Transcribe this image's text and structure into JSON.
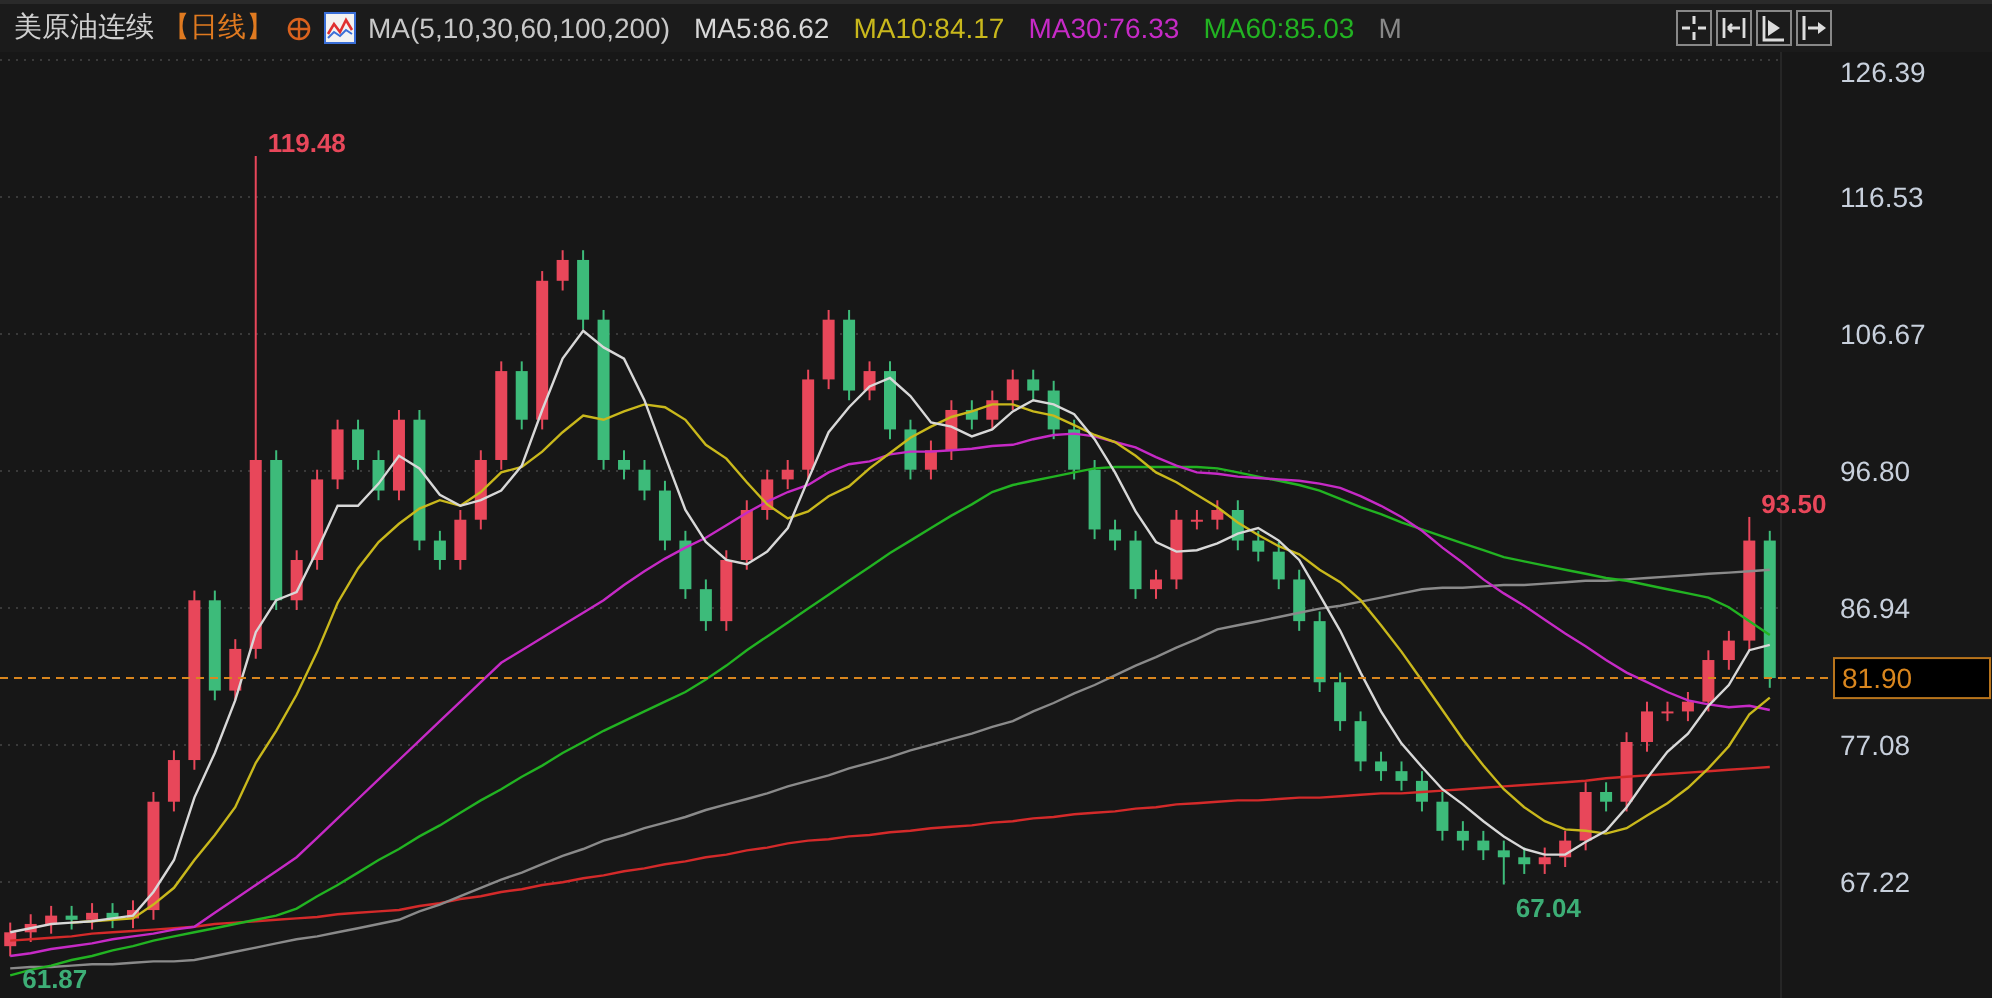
{
  "header": {
    "title": "美原油连续",
    "period": "【日线】",
    "indicator": "MA(5,10,30,60,100,200)",
    "ma_values": [
      {
        "label": "MA5:86.62",
        "color": "#d8d8d8"
      },
      {
        "label": "MA10:84.17",
        "color": "#c9b81c"
      },
      {
        "label": "MA30:76.33",
        "color": "#c62ac6"
      },
      {
        "label": "MA60:85.03",
        "color": "#22b322"
      }
    ],
    "more": "M"
  },
  "chart_data": {
    "type": "candlestick",
    "grid": true,
    "ylim": [
      58.87,
      126.97
    ],
    "categories": [
      null,
      null,
      null,
      null,
      null,
      null,
      null,
      null,
      null,
      null,
      null,
      null,
      null,
      null,
      null,
      null,
      null,
      null,
      null,
      null,
      null,
      null,
      null,
      null,
      null,
      null,
      null,
      null,
      null,
      null,
      null,
      null,
      null,
      null,
      null,
      null,
      null,
      null,
      null,
      null,
      null,
      null,
      null,
      null,
      null,
      null,
      null,
      null,
      null,
      null,
      null,
      null,
      null,
      null,
      null,
      null,
      null,
      null,
      null,
      null,
      null,
      null,
      null,
      null,
      null,
      null,
      null,
      null,
      null,
      null,
      null,
      null,
      null,
      null,
      null,
      null,
      null,
      null,
      null,
      null,
      null,
      null,
      null,
      null,
      null,
      null,
      null
    ],
    "yticks": [
      {
        "value": 126.39,
        "label": "126.39"
      },
      {
        "value": 116.53,
        "label": "116.53"
      },
      {
        "value": 106.67,
        "label": "106.67"
      },
      {
        "value": 96.8,
        "label": "96.80"
      },
      {
        "value": 86.94,
        "label": "86.94"
      },
      {
        "value": 77.08,
        "label": "77.08"
      },
      {
        "value": 67.22,
        "label": "67.22"
      }
    ],
    "ohlc": [
      [
        62.6,
        64.3,
        61.87,
        63.6
      ],
      [
        63.6,
        64.9,
        62.9,
        64.2
      ],
      [
        64.2,
        65.5,
        63.5,
        64.8
      ],
      [
        64.8,
        65.5,
        63.8,
        64.5
      ],
      [
        64.5,
        65.7,
        63.8,
        65
      ],
      [
        65,
        65.7,
        63.9,
        64.6
      ],
      [
        64.6,
        65.9,
        63.9,
        65.2
      ],
      [
        65.2,
        73.7,
        64.5,
        73
      ],
      [
        73,
        76.7,
        72.3,
        76
      ],
      [
        76,
        88.2,
        75.3,
        87.5
      ],
      [
        87.5,
        88.2,
        80.3,
        81
      ],
      [
        81,
        84.7,
        80.3,
        84
      ],
      [
        84,
        119.48,
        83.3,
        97.6
      ],
      [
        97.6,
        98.3,
        86.8,
        87.5
      ],
      [
        87.5,
        91.1,
        86.8,
        90.4
      ],
      [
        90.4,
        96.9,
        89.7,
        96.2
      ],
      [
        96.2,
        100.5,
        95.5,
        99.8
      ],
      [
        99.8,
        100.5,
        96.9,
        97.6
      ],
      [
        97.6,
        98.3,
        94.7,
        95.4
      ],
      [
        95.4,
        101.2,
        94.7,
        100.5
      ],
      [
        100.5,
        101.2,
        91.1,
        91.8
      ],
      [
        91.8,
        92.5,
        89.7,
        90.4
      ],
      [
        90.4,
        94,
        89.7,
        93.3
      ],
      [
        93.3,
        98.3,
        92.6,
        97.6
      ],
      [
        97.6,
        104.7,
        96.9,
        104
      ],
      [
        104,
        104.7,
        99.8,
        100.5
      ],
      [
        100.5,
        111.2,
        99.8,
        110.5
      ],
      [
        110.5,
        112.7,
        109.8,
        112
      ],
      [
        112,
        112.7,
        107,
        107.7
      ],
      [
        107.7,
        108.4,
        96.9,
        97.6
      ],
      [
        97.6,
        98.3,
        96.2,
        96.9
      ],
      [
        96.9,
        97.6,
        94.7,
        95.4
      ],
      [
        95.4,
        96.1,
        91.1,
        91.8
      ],
      [
        91.8,
        92.5,
        87.6,
        88.3
      ],
      [
        88.3,
        89,
        85.3,
        86
      ],
      [
        86,
        91.1,
        85.3,
        90.4
      ],
      [
        90.4,
        94.7,
        89.7,
        94
      ],
      [
        94,
        96.9,
        93.3,
        96.2
      ],
      [
        96.2,
        97.6,
        95.5,
        96.9
      ],
      [
        96.9,
        104.1,
        96.2,
        103.4
      ],
      [
        103.4,
        108.4,
        102.7,
        107.7
      ],
      [
        107.7,
        108.4,
        101.9,
        102.6
      ],
      [
        102.6,
        104.7,
        101.9,
        104
      ],
      [
        104,
        104.7,
        99.1,
        99.8
      ],
      [
        99.8,
        100.5,
        96.2,
        96.9
      ],
      [
        96.9,
        99,
        96.2,
        98.3
      ],
      [
        98.3,
        101.9,
        97.6,
        101.2
      ],
      [
        101.2,
        101.9,
        99.8,
        100.5
      ],
      [
        100.5,
        102.6,
        99.8,
        101.9
      ],
      [
        101.9,
        104.1,
        101.2,
        103.4
      ],
      [
        103.4,
        104.1,
        101.9,
        102.6
      ],
      [
        102.6,
        103.3,
        99.1,
        99.8
      ],
      [
        99.8,
        100.5,
        96.2,
        96.9
      ],
      [
        96.9,
        97.6,
        91.9,
        92.6
      ],
      [
        92.6,
        93.3,
        91.1,
        91.8
      ],
      [
        91.8,
        92.5,
        87.6,
        88.3
      ],
      [
        88.3,
        89.7,
        87.6,
        89
      ],
      [
        89,
        94,
        88.3,
        93.3
      ],
      [
        93.3,
        94,
        92.6,
        93.3
      ],
      [
        93.3,
        94.7,
        92.6,
        94
      ],
      [
        94,
        94.7,
        91.1,
        91.8
      ],
      [
        91.8,
        92.5,
        90.3,
        91
      ],
      [
        91,
        91.7,
        88.3,
        89
      ],
      [
        89,
        89.7,
        85.3,
        86
      ],
      [
        86,
        86.7,
        80.9,
        81.6
      ],
      [
        81.6,
        82.3,
        78.1,
        78.8
      ],
      [
        78.8,
        79.5,
        75.2,
        75.9
      ],
      [
        75.9,
        76.6,
        74.5,
        75.2
      ],
      [
        75.2,
        75.9,
        73.8,
        74.5
      ],
      [
        74.5,
        75.2,
        72.3,
        73
      ],
      [
        73,
        73.7,
        70.2,
        70.9
      ],
      [
        70.9,
        71.6,
        69.5,
        70.2
      ],
      [
        70.2,
        70.9,
        68.8,
        69.5
      ],
      [
        69.5,
        70.2,
        67.04,
        69
      ],
      [
        69,
        69.7,
        67.8,
        68.5
      ],
      [
        68.5,
        69.7,
        67.8,
        69
      ],
      [
        69,
        70.9,
        68.3,
        70.2
      ],
      [
        70.2,
        74.4,
        69.5,
        73.7
      ],
      [
        73.7,
        74.4,
        72.3,
        73
      ],
      [
        73,
        78,
        72.3,
        77.3
      ],
      [
        77.3,
        80.2,
        76.6,
        79.5
      ],
      [
        79.5,
        80.2,
        78.8,
        79.5
      ],
      [
        79.5,
        80.9,
        78.8,
        80.2
      ],
      [
        80.2,
        83.9,
        79.5,
        83.2
      ],
      [
        83.2,
        85.3,
        82.5,
        84.6
      ],
      [
        84.6,
        93.5,
        83.9,
        91.8
      ],
      [
        91.8,
        92.5,
        81.2,
        81.9
      ]
    ],
    "series": [
      {
        "type": "line",
        "color": "#d8d8d8",
        "values": [
          63.6,
          63.9,
          64.2,
          64.3,
          64.4,
          64.6,
          64.8,
          66.5,
          68.8,
          73.3,
          76.5,
          80.3,
          85.2,
          87.5,
          88.1,
          91.1,
          94.3,
          94.3,
          95.9,
          97.9,
          97,
          95.1,
          94.3,
          94.7,
          95.4,
          97.2,
          101.2,
          104.9,
          106.9,
          105.7,
          104.9,
          101.9,
          97.9,
          94,
          91.7,
          90.4,
          90.1,
          91,
          92.7,
          96.2,
          99.6,
          101.4,
          102.9,
          103.5,
          102.2,
          100.3,
          100,
          99.3,
          99.8,
          101.1,
          101.9,
          101.6,
          100.9,
          99.1,
          96.7,
          93.9,
          91.7,
          91,
          91.1,
          91.6,
          92.3,
          92.7,
          91.8,
          90.4,
          87.9,
          85.3,
          82.3,
          79.5,
          77.2,
          75.5,
          73.9,
          72.8,
          71.6,
          70.5,
          69.6,
          69.2,
          69.2,
          70.1,
          70.9,
          72.6,
          74.7,
          76.6,
          77.9,
          79.9,
          81.4,
          83.9,
          84.3
        ]
      },
      {
        "type": "line",
        "color": "#c9b81c",
        "values": [
          null,
          null,
          null,
          64.3,
          64.4,
          64.5,
          64.6,
          65.6,
          66.8,
          68.8,
          70.6,
          72.6,
          75.8,
          78.1,
          80.7,
          83.8,
          87.3,
          89.8,
          91.7,
          93,
          94.1,
          94.7,
          94.3,
          95.3,
          96.7,
          97.1,
          98.2,
          99.6,
          100.8,
          100.5,
          101.1,
          101.6,
          101.4,
          100.5,
          98.7,
          97.7,
          96,
          94.4,
          93.4,
          93.9,
          95,
          95.7,
          97,
          98.1,
          99.2,
          100,
          100.7,
          101.1,
          101.6,
          101.6,
          101.1,
          100.8,
          100.1,
          99.4,
          98.9,
          97.9,
          96.7,
          96,
          95.1,
          94.2,
          93.1,
          92.2,
          91.4,
          90.8,
          89.7,
          88.8,
          87.5,
          85.7,
          83.8,
          81.7,
          79.6,
          77.5,
          75.6,
          73.9,
          72.6,
          71.6,
          71,
          70.9,
          70.7,
          71.1,
          72,
          72.9,
          74,
          75.4,
          77,
          79.3,
          80.5
        ]
      },
      {
        "type": "line",
        "color": "#c62ac6",
        "values": [
          61.9,
          62.1,
          62.4,
          62.6,
          62.8,
          63.1,
          63.3,
          63.5,
          63.8,
          64,
          65,
          66,
          67,
          68,
          69,
          70.4,
          71.8,
          73.2,
          74.6,
          76,
          77.4,
          78.8,
          80.2,
          81.6,
          83,
          83.9,
          84.8,
          85.7,
          86.6,
          87.5,
          88.6,
          89.6,
          90.5,
          91.3,
          92,
          92.9,
          93.8,
          94.6,
          95.3,
          95.8,
          96.7,
          97.3,
          97.5,
          98,
          98.2,
          98.2,
          98.3,
          98.4,
          98.6,
          98.7,
          99.1,
          99.4,
          99.5,
          99.3,
          98.9,
          98.5,
          97.8,
          97.2,
          96.7,
          96.6,
          96.4,
          96.3,
          96.2,
          96.1,
          95.9,
          95.6,
          95,
          94.3,
          93.5,
          92.5,
          91.3,
          90.2,
          89,
          88,
          87.1,
          86.1,
          85.1,
          84.2,
          83.2,
          82.3,
          81.6,
          80.9,
          80.3,
          80,
          79.8,
          79.9,
          79.6
        ]
      },
      {
        "type": "line",
        "color": "#22b322",
        "values": [
          60.5,
          60.9,
          61.2,
          61.6,
          61.9,
          62.3,
          62.6,
          63,
          63.3,
          63.6,
          63.9,
          64.2,
          64.5,
          64.8,
          65.3,
          66.2,
          67,
          67.9,
          68.8,
          69.6,
          70.5,
          71.3,
          72.2,
          73.1,
          73.9,
          74.8,
          75.6,
          76.5,
          77.3,
          78.1,
          78.8,
          79.5,
          80.2,
          80.9,
          81.8,
          82.8,
          83.9,
          84.9,
          85.9,
          86.9,
          87.9,
          88.9,
          89.9,
          90.9,
          91.8,
          92.7,
          93.6,
          94.4,
          95.3,
          95.8,
          96.1,
          96.4,
          96.7,
          97,
          97.1,
          97.1,
          97.1,
          97.1,
          97.1,
          97,
          96.7,
          96.4,
          96.1,
          95.8,
          95.4,
          94.8,
          94.2,
          93.7,
          93.1,
          92.6,
          92.1,
          91.6,
          91.1,
          90.6,
          90.3,
          90,
          89.7,
          89.4,
          89.1,
          88.9,
          88.6,
          88.3,
          88,
          87.7,
          87,
          86,
          85
        ]
      },
      {
        "type": "line",
        "color": "#8a8a8a",
        "values": [
          61,
          61.1,
          61.1,
          61.2,
          61.3,
          61.3,
          61.4,
          61.5,
          61.5,
          61.6,
          61.9,
          62.2,
          62.5,
          62.8,
          63.1,
          63.3,
          63.6,
          63.9,
          64.2,
          64.5,
          65.1,
          65.6,
          66.2,
          66.8,
          67.4,
          67.9,
          68.5,
          69.1,
          69.6,
          70.2,
          70.6,
          71.1,
          71.5,
          71.9,
          72.4,
          72.8,
          73.2,
          73.6,
          74.1,
          74.5,
          74.9,
          75.4,
          75.8,
          76.2,
          76.7,
          77.1,
          77.5,
          77.9,
          78.4,
          78.8,
          79.5,
          80.1,
          80.8,
          81.4,
          82.1,
          82.8,
          83.4,
          84.1,
          84.7,
          85.4,
          85.7,
          86,
          86.3,
          86.6,
          86.9,
          87.1,
          87.4,
          87.7,
          88,
          88.3,
          88.4,
          88.4,
          88.5,
          88.6,
          88.6,
          88.7,
          88.8,
          88.9,
          88.9,
          89,
          89.1,
          89.2,
          89.3,
          89.4,
          89.5,
          89.6,
          89.7
        ]
      },
      {
        "type": "line",
        "color": "#d42a2a",
        "values": [
          63,
          63.1,
          63.2,
          63.3,
          63.5,
          63.6,
          63.7,
          63.8,
          63.9,
          64,
          64.2,
          64.3,
          64.4,
          64.5,
          64.6,
          64.7,
          64.9,
          65,
          65.1,
          65.2,
          65.5,
          65.7,
          66,
          66.2,
          66.5,
          66.7,
          67,
          67.2,
          67.5,
          67.7,
          68,
          68.2,
          68.5,
          68.7,
          69,
          69.2,
          69.5,
          69.7,
          70,
          70.2,
          70.3,
          70.5,
          70.6,
          70.8,
          70.9,
          71.1,
          71.2,
          71.3,
          71.5,
          71.6,
          71.8,
          71.9,
          72.1,
          72.2,
          72.3,
          72.5,
          72.6,
          72.8,
          72.9,
          73,
          73.1,
          73.1,
          73.2,
          73.3,
          73.3,
          73.4,
          73.5,
          73.6,
          73.6,
          73.7,
          73.8,
          73.9,
          74,
          74.1,
          74.2,
          74.3,
          74.4,
          74.5,
          74.7,
          74.8,
          74.9,
          75,
          75.1,
          75.2,
          75.3,
          75.4,
          75.5
        ]
      }
    ],
    "ref_lines": [
      {
        "axis": "y",
        "value": 81.9,
        "label": "81.90"
      }
    ],
    "annotations": [
      "119.48",
      "93.50",
      "67.04",
      "61.87"
    ]
  }
}
